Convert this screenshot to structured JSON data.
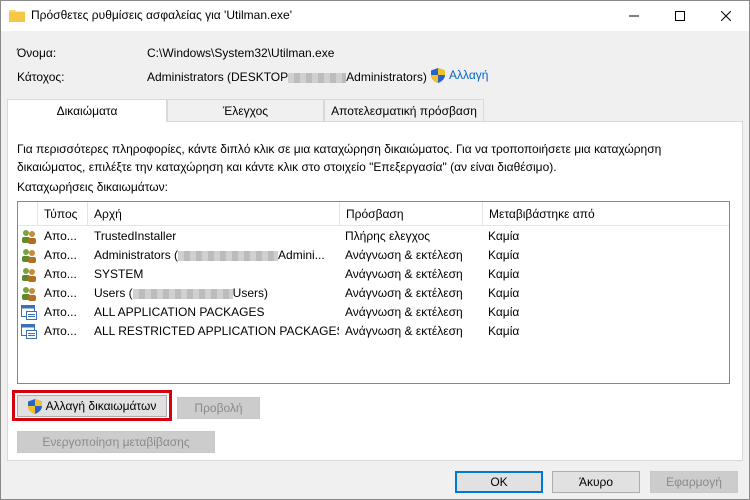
{
  "window": {
    "title": "Πρόσθετες ρυθμίσεις ασφαλείας για 'Utilman.exe'",
    "minimize_icon": "minimize-icon",
    "maximize_icon": "maximize-icon",
    "close_icon": "close-icon"
  },
  "object": {
    "name_label": "Όνομα:",
    "name_value": "C:\\Windows\\System32\\Utilman.exe",
    "owner_label": "Κάτοχος:",
    "owner_value_prefix": "Administrators (DESKTOP",
    "owner_value_suffix": "Administrators)",
    "change_link": "Αλλαγή"
  },
  "tabs": [
    {
      "label": "Δικαιώματα",
      "active": true
    },
    {
      "label": "Έλεγχος",
      "active": false
    },
    {
      "label": "Αποτελεσματική πρόσβαση",
      "active": false
    }
  ],
  "info_text": "Για περισσότερες πληροφορίες, κάντε διπλό κλικ σε μια καταχώρηση δικαιώματος. Για να τροποποιήσετε μια καταχώρηση δικαιώματος, επιλέξτε την καταχώρηση και κάντε κλικ στο στοιχείο \"Επεξεργασία\" (αν είναι διαθέσιμο).",
  "entries_label": "Καταχωρήσεις δικαιωμάτων:",
  "table": {
    "headers": [
      "Τύπος",
      "Αρχή",
      "Πρόσβαση",
      "Μεταβιβάστηκε από"
    ],
    "rows": [
      {
        "type": "Απο...",
        "principal": "TrustedInstaller",
        "principal_tail": "",
        "access": "Πλήρης ελεγχος",
        "inherited": "Καμία",
        "icon": "users-icon"
      },
      {
        "type": "Απο...",
        "principal": "Administrators (",
        "principal_tail": "Admini...",
        "access": "Ανάγνωση & εκτέλεση",
        "inherited": "Καμία",
        "icon": "users-icon"
      },
      {
        "type": "Απο...",
        "principal": "SYSTEM",
        "principal_tail": "",
        "access": "Ανάγνωση & εκτέλεση",
        "inherited": "Καμία",
        "icon": "users-icon"
      },
      {
        "type": "Απο...",
        "principal": "Users (",
        "principal_tail": "Users)",
        "access": "Ανάγνωση & εκτέλεση",
        "inherited": "Καμία",
        "icon": "users-icon"
      },
      {
        "type": "Απο...",
        "principal": "ALL APPLICATION PACKAGES",
        "principal_tail": "",
        "access": "Ανάγνωση & εκτέλεση",
        "inherited": "Καμία",
        "icon": "app-packages-icon"
      },
      {
        "type": "Απο...",
        "principal": "ALL RESTRICTED APPLICATION PACKAGES",
        "principal_tail": "",
        "access": "Ανάγνωση & εκτέλεση",
        "inherited": "Καμία",
        "icon": "app-packages-icon"
      }
    ]
  },
  "buttons": {
    "change_permissions": "Αλλαγή δικαιωμάτων",
    "view": "Προβολή",
    "enable_inheritance": "Ενεργοποίηση μεταβίβασης",
    "ok": "OK",
    "cancel": "Άκυρο",
    "apply": "Εφαρμογή"
  },
  "colors": {
    "highlight": "#d9000d",
    "link": "#0066cc",
    "default_button_border": "#0078d7"
  }
}
